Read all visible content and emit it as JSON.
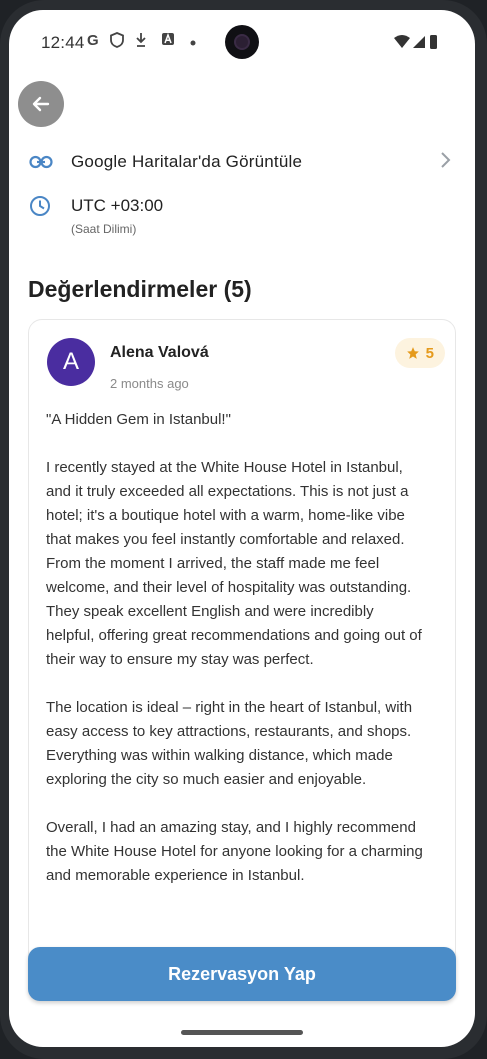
{
  "status_bar": {
    "time": "12:44",
    "icons": [
      "google-g-icon",
      "shield-icon",
      "download-icon",
      "a-box-icon",
      "dot-icon"
    ],
    "right_icons": [
      "wifi-icon",
      "signal-icon",
      "battery-icon"
    ]
  },
  "info": {
    "maps_link_label": "Google Haritalar'da Görüntüle",
    "timezone_value": "UTC +03:00",
    "timezone_label": "(Saat Dilimi)"
  },
  "reviews": {
    "title": "Değerlendirmeler (5)",
    "items": [
      {
        "avatar_letter": "A",
        "name": "Alena Valová",
        "date": "2 months ago",
        "rating": "5",
        "text": "\"A Hidden Gem in Istanbul!\"\n\nI recently stayed at the White House Hotel in Istanbul, and it truly exceeded all expectations. This is not just a hotel; it's a boutique hotel with a warm, home-like vibe that makes you feel instantly comfortable and relaxed. From the moment I arrived, the staff made me feel welcome, and their level of hospitality was outstanding. They speak excellent English and were incredibly helpful, offering great recommendations and going out of their way to ensure my stay was perfect.\n\nThe location is ideal – right in the heart of Istanbul, with easy access to key attractions, restaurants, and shops. Everything was within walking distance, which made exploring the city so much easier and enjoyable.\n\nOverall, I had an amazing stay, and I highly recommend the White House Hotel for anyone looking for a charming and memorable experience in Istanbul."
      }
    ]
  },
  "cta": {
    "label": "Rezervasyon Yap"
  },
  "colors": {
    "accent": "#4a8cc8",
    "icon_blue": "#4a86c5",
    "avatar": "#4a2da0",
    "star": "#e59a1c"
  }
}
